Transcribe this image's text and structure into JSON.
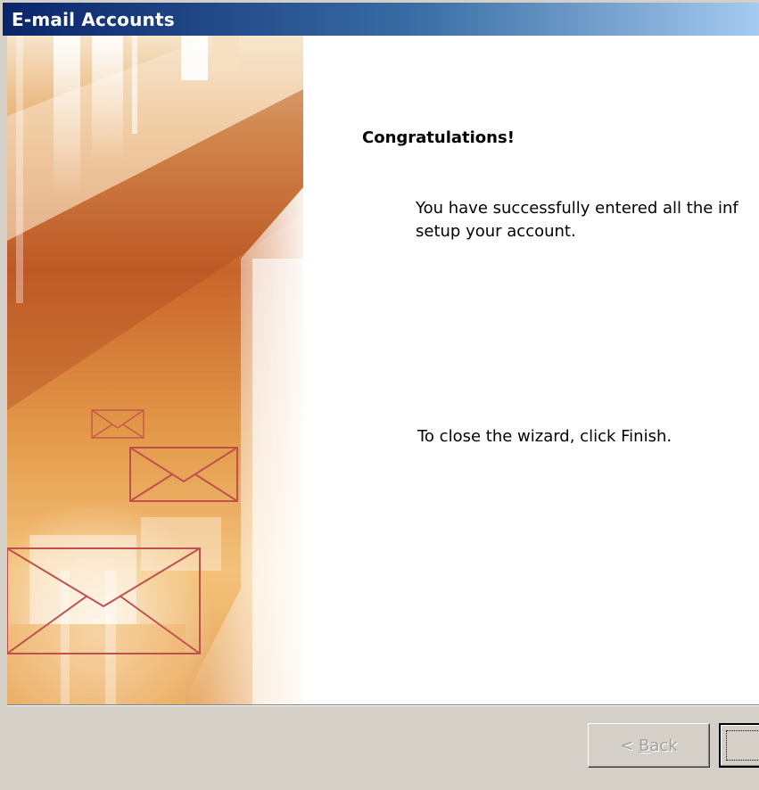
{
  "window": {
    "title": "E-mail Accounts"
  },
  "wizard": {
    "heading": "Congratulations!",
    "message_line1": "You have successfully entered all the inf",
    "message_line2": "setup your account.",
    "close_instruction": "To close the wizard, click Finish."
  },
  "buttons": {
    "back_prefix": "< ",
    "back_accel": "B",
    "back_rest": "ack",
    "back_disabled": true,
    "finish_label": ""
  },
  "colors": {
    "title_gradient_start": "#0a246a",
    "title_gradient_end": "#a6caf0",
    "dialog_face": "#d4d0c8",
    "banner_orange": "#d9823a",
    "envelope_stroke": "#c0504d"
  },
  "icons": {
    "banner_envelopes": "envelope-icon"
  }
}
